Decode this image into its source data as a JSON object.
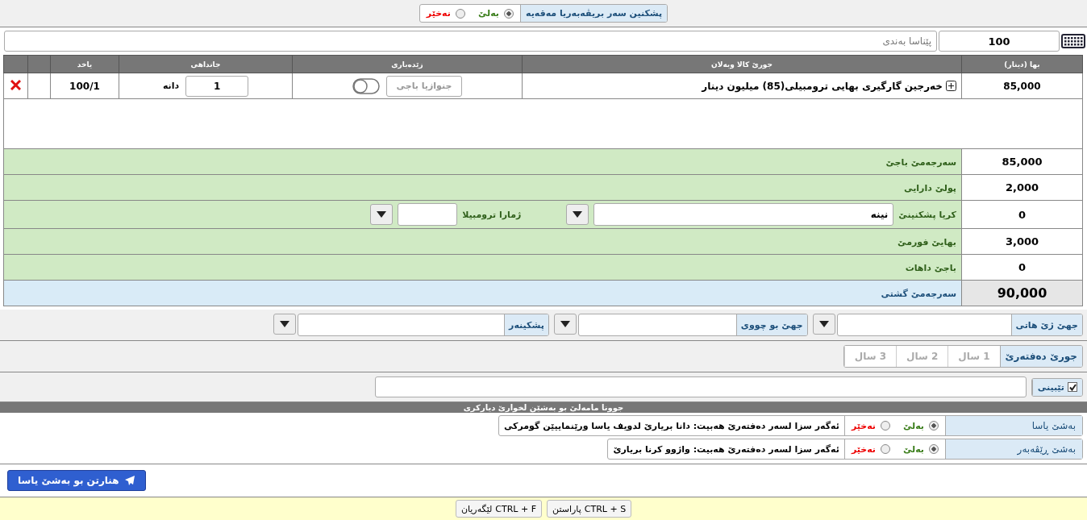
{
  "inspection": {
    "label": "پشکنین سەر بریڤەبەریا مەقەیە",
    "options": [
      {
        "label": "بەلێ",
        "kind": "yes",
        "selected": true
      },
      {
        "label": "نەخێر",
        "kind": "no",
        "selected": false
      }
    ]
  },
  "item_entry": {
    "code": "100",
    "placeholder": "پێناسا بەندی"
  },
  "table": {
    "columns": [
      "بها (دینار)",
      "جورێ کالا وبەلان",
      "زێدەباری",
      "جانداهی",
      "یاخد"
    ],
    "rows": [
      {
        "price": "85,000",
        "description": "خەرجین گارگیری بهایی ترومبیلی(85) میلیون دینار",
        "extra_button": "جنوازیا باجی",
        "toggle_on": false,
        "quantity": "1",
        "unit": "دانە",
        "ratio": "100/1"
      }
    ]
  },
  "summary": [
    {
      "kind": "plain",
      "label": "سەرجەمێ باجێ",
      "value": "85,000"
    },
    {
      "kind": "plain",
      "label": "پولێ دارایی",
      "value": "2,000"
    },
    {
      "kind": "selects",
      "label": "کریا پشکنینێ",
      "value": "0",
      "select_value": "نینە",
      "second_label": "ژمارا ترومبیلا"
    },
    {
      "kind": "plain",
      "label": "بهایێ فورمێ",
      "value": "3,000"
    },
    {
      "kind": "plain",
      "label": "باجێ داهات",
      "value": "0"
    },
    {
      "kind": "total",
      "label": "سەرجەمێ گشتی",
      "value": "90,000"
    }
  ],
  "locations": [
    "جهێ ژێ هاتی",
    "جهێ بو چووی",
    "پشکینەر"
  ],
  "book_type": {
    "label": "جورێ دەفتەرێ",
    "options": [
      {
        "label": "1 سال",
        "disabled": true
      },
      {
        "label": "2 سال",
        "disabled": true
      },
      {
        "label": "3 سال",
        "disabled": true
      }
    ]
  },
  "note": {
    "label": "تێبینی",
    "checked": true
  },
  "routing": {
    "title": "جوونا مامەلێ بو بەشێن لخوارێ دیارکری",
    "rows": [
      {
        "department": "بەشێ یاسا",
        "yes": "بەلێ",
        "no": "نەخێر",
        "yes_selected": true,
        "question": "ئەگەر سزا لسەر دەفتەرێ هەبیت: دانا بریارێ لدویف یاسا ورێنماییێن گومرکی"
      },
      {
        "department": "بەشێ ڕێڤەبەر",
        "yes": "بەلێ",
        "no": "نەخێر",
        "yes_selected": true,
        "question": "ئەگەر سزا لسەر دەفتەرێ هەبیت: واژوو کرنا بریارێ"
      }
    ]
  },
  "send_button": "هنارتن بو بەشێ یاسا",
  "shortcuts": [
    {
      "keys": "CTRL + S",
      "label": "پاراستن"
    },
    {
      "keys": "CTRL + F",
      "label": "لێگەریان"
    }
  ]
}
